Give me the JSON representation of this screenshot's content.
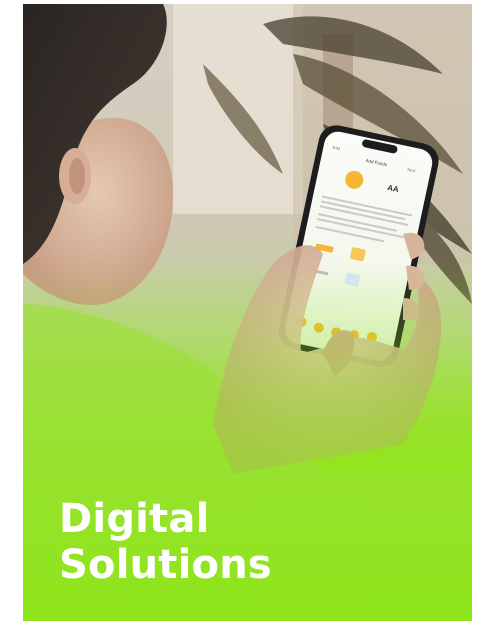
{
  "poster": {
    "title_line_1": "Digital",
    "title_line_2": "Solutions"
  },
  "phone": {
    "status_time": "9:41",
    "screen_title": "Add Funds",
    "amount_label": "AA",
    "next_label": "Next"
  },
  "colors": {
    "background_green": "#8ee51a",
    "title_text": "#ffffff",
    "app_accent": "#f5b731"
  }
}
